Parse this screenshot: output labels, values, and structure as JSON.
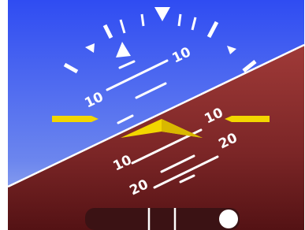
{
  "attitude_indicator": {
    "pitch_labels": {
      "sky_left": "10",
      "sky_right": "10",
      "ground_left_10": "10",
      "ground_right_10": "10",
      "ground_left_20": "20",
      "ground_right_20": "20"
    }
  },
  "colors": {
    "sky_top": "#2f4cf2",
    "sky_bottom": "#8ea8ee",
    "ground_top": "#9b3433",
    "ground_bottom": "#5a1416",
    "horizon_line": "#ffffff",
    "aircraft_symbol": "#f2d600",
    "slip_track": "#3b1214",
    "slip_ball": "#ffffff"
  },
  "icons": {
    "aircraft": "aircraft-symbol-icon",
    "bank_pointer": "bank-pointer-icon",
    "sky_pointer": "sky-pointer-icon",
    "slip_ball": "slip-ball-icon"
  }
}
